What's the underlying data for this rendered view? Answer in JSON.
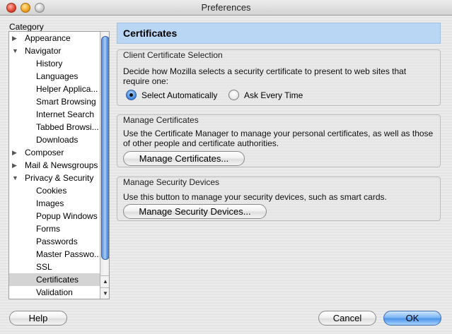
{
  "window": {
    "title": "Preferences"
  },
  "category_label": "Category",
  "tree": {
    "items": [
      {
        "label": "Appearance",
        "level": 0,
        "twisty": "▶"
      },
      {
        "label": "Navigator",
        "level": 0,
        "twisty": "▼"
      },
      {
        "label": "History",
        "level": 1
      },
      {
        "label": "Languages",
        "level": 1
      },
      {
        "label": "Helper Applica...",
        "level": 1
      },
      {
        "label": "Smart Browsing",
        "level": 1
      },
      {
        "label": "Internet Search",
        "level": 1
      },
      {
        "label": "Tabbed Browsi...",
        "level": 1
      },
      {
        "label": "Downloads",
        "level": 1
      },
      {
        "label": "Composer",
        "level": 0,
        "twisty": "▶"
      },
      {
        "label": "Mail & Newsgroups",
        "level": 0,
        "twisty": "▶"
      },
      {
        "label": "Privacy & Security",
        "level": 0,
        "twisty": "▼"
      },
      {
        "label": "Cookies",
        "level": 1
      },
      {
        "label": "Images",
        "level": 1
      },
      {
        "label": "Popup Windows",
        "level": 1
      },
      {
        "label": "Forms",
        "level": 1
      },
      {
        "label": "Passwords",
        "level": 1
      },
      {
        "label": "Master Passwo...",
        "level": 1
      },
      {
        "label": "SSL",
        "level": 1
      },
      {
        "label": "Certificates",
        "level": 1,
        "selected": true
      },
      {
        "label": "Validation",
        "level": 1
      }
    ]
  },
  "pane": {
    "title": "Certificates",
    "client_cert": {
      "caption": "Client Certificate Selection",
      "description_line1": "Decide how Mozilla selects a security certificate to present to web sites that",
      "description_line2": "require one:",
      "option_auto": "Select Automatically",
      "option_ask": "Ask Every Time",
      "selected": "Select Automatically"
    },
    "manage_certs": {
      "caption": "Manage Certificates",
      "description_line1": "Use the Certificate Manager to manage your personal certificates, as well as those",
      "description_line2": "of other people and certificate authorities.",
      "button": "Manage Certificates..."
    },
    "manage_devices": {
      "caption": "Manage Security Devices",
      "description": "Use this button to manage your security devices, such as smart cards.",
      "button": "Manage Security Devices..."
    }
  },
  "footer": {
    "help": "Help",
    "cancel": "Cancel",
    "ok": "OK"
  }
}
